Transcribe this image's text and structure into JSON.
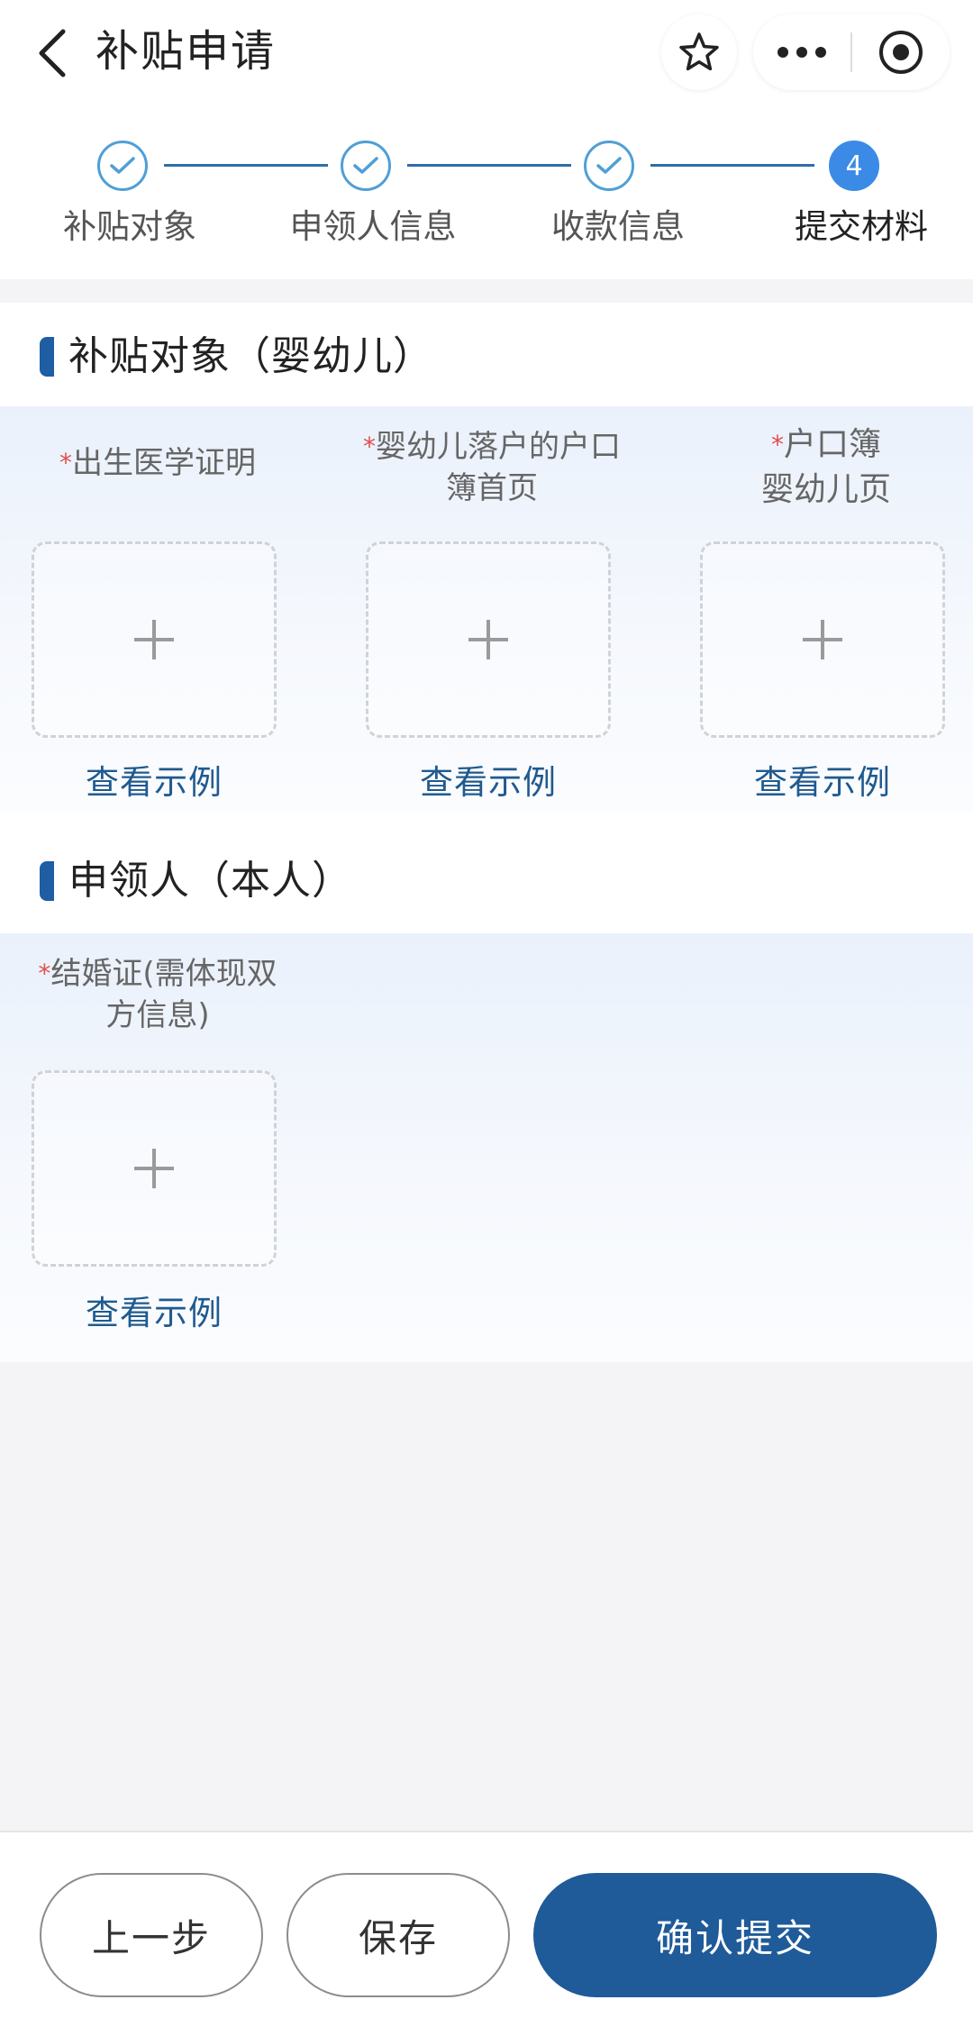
{
  "nav": {
    "title": "补贴申请",
    "icons": [
      "back-chevron-icon",
      "star-icon",
      "more-dots-icon",
      "target-icon"
    ]
  },
  "steps": [
    {
      "label": "补贴对象",
      "status": "done"
    },
    {
      "label": "申领人信息",
      "status": "done"
    },
    {
      "label": "收款信息",
      "status": "done"
    },
    {
      "label": "提交材料",
      "status": "active",
      "number": "4"
    }
  ],
  "sections": [
    {
      "title": "补贴对象（婴幼儿）",
      "items": [
        {
          "required": "*",
          "label_line1": "出生医学证明",
          "label_line2": "",
          "example": "查看示例"
        },
        {
          "required": "*",
          "label_line1": "婴幼儿落户的户口",
          "label_line2": "簿首页",
          "example": "查看示例"
        },
        {
          "required": "*",
          "label_line1": "户口簿",
          "label_line2": "婴幼儿页",
          "example": "查看示例"
        }
      ]
    },
    {
      "title": "申领人（本人）",
      "items": [
        {
          "required": "*",
          "label_line1": "结婚证(需体现双",
          "label_line2": "方信息)",
          "example": "查看示例"
        }
      ]
    }
  ],
  "actions": {
    "prev": "上一步",
    "save": "保存",
    "submit": "确认提交"
  },
  "colors": {
    "primary": "#1f5a99",
    "step_done": "#4f9fd6",
    "step_active": "#3b8be6",
    "required": "#e05050",
    "link": "#1f5a8f"
  }
}
